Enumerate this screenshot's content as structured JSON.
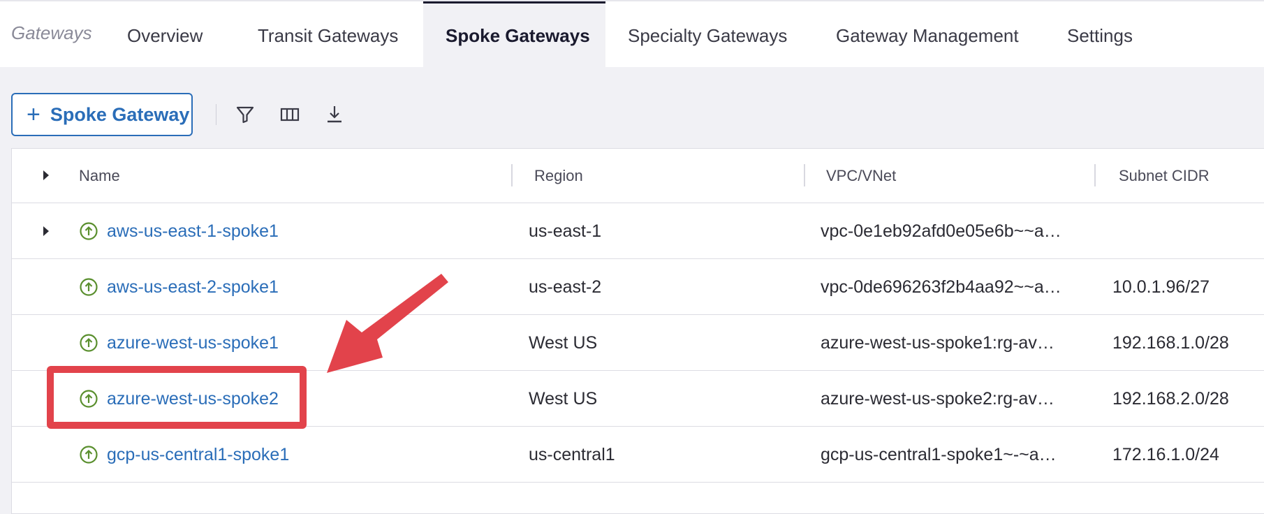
{
  "nav": {
    "section": "Gateways",
    "tabs": [
      {
        "label": "Overview"
      },
      {
        "label": "Transit Gateways"
      },
      {
        "label": "Spoke Gateways"
      },
      {
        "label": "Specialty Gateways"
      },
      {
        "label": "Gateway Management"
      },
      {
        "label": "Settings"
      }
    ],
    "active_tab": "Spoke Gateways"
  },
  "toolbar": {
    "add_label": "Spoke Gateway",
    "icons": [
      "filter-icon",
      "columns-icon",
      "download-icon"
    ]
  },
  "table": {
    "columns": [
      "Name",
      "Region",
      "VPC/VNet",
      "Subnet CIDR"
    ],
    "rows": [
      {
        "name": "aws-us-east-1-spoke1",
        "region": "us-east-1",
        "vpc": "vpc-0e1eb92afd0e05e6b~~a…",
        "cidr": ""
      },
      {
        "name": "aws-us-east-2-spoke1",
        "region": "us-east-2",
        "vpc": "vpc-0de696263f2b4aa92~~a…",
        "cidr": "10.0.1.96/27"
      },
      {
        "name": "azure-west-us-spoke1",
        "region": "West US",
        "vpc": "azure-west-us-spoke1:rg-av…",
        "cidr": "192.168.1.0/28"
      },
      {
        "name": "azure-west-us-spoke2",
        "region": "West US",
        "vpc": "azure-west-us-spoke2:rg-av…",
        "cidr": "192.168.2.0/28"
      },
      {
        "name": "gcp-us-central1-spoke1",
        "region": "us-central1",
        "vpc": "gcp-us-central1-spoke1~-~a…",
        "cidr": "172.16.1.0/24"
      }
    ]
  },
  "colors": {
    "accent": "#2a6db8",
    "status_up": "#5a8f2e",
    "annotation": "#e2434b"
  }
}
